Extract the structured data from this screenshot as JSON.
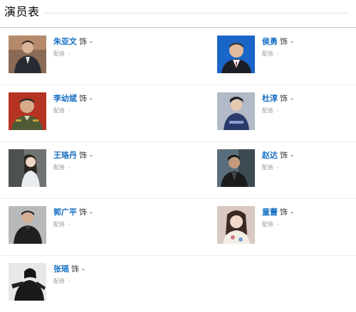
{
  "section": {
    "title": "演员表"
  },
  "cast": [
    {
      "name": "朱亚文",
      "role_label": "饰",
      "role": "-",
      "dub_label": "配音",
      "dub": "-",
      "photo": "actor-photo"
    },
    {
      "name": "侯勇",
      "role_label": "饰",
      "role": "-",
      "dub_label": "配音",
      "dub": "-",
      "photo": "actor-photo"
    },
    {
      "name": "李幼斌",
      "role_label": "饰",
      "role": "-",
      "dub_label": "配音",
      "dub": "-",
      "photo": "actor-photo"
    },
    {
      "name": "杜淳",
      "role_label": "饰",
      "role": "-",
      "dub_label": "配音",
      "dub": "-",
      "photo": "actor-photo"
    },
    {
      "name": "王珞丹",
      "role_label": "饰",
      "role": "-",
      "dub_label": "配音",
      "dub": "-",
      "photo": "actor-photo"
    },
    {
      "name": "赵达",
      "role_label": "饰",
      "role": "-",
      "dub_label": "配音",
      "dub": "-",
      "photo": "actor-photo"
    },
    {
      "name": "郭广平",
      "role_label": "饰",
      "role": "-",
      "dub_label": "配音",
      "dub": "-",
      "photo": "actor-photo"
    },
    {
      "name": "童蕾",
      "role_label": "饰",
      "role": "-",
      "dub_label": "配音",
      "dub": "-",
      "photo": "actor-photo"
    },
    {
      "name": "张瑶",
      "role_label": "饰",
      "role": "-",
      "dub_label": "配音",
      "dub": "-",
      "photo": "actor-photo"
    }
  ],
  "colors": {
    "link": "#136ec2",
    "muted": "#999999",
    "divider": "#ededed"
  }
}
